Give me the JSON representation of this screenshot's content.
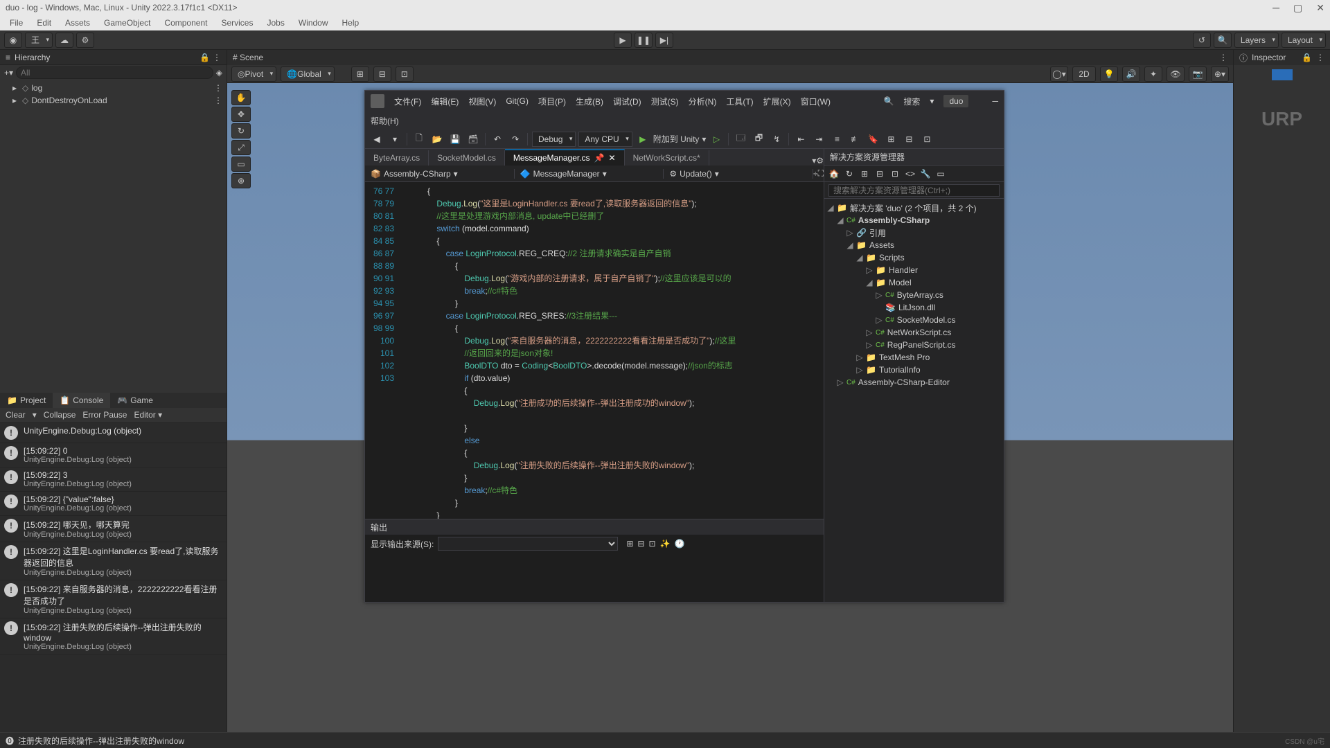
{
  "window": {
    "title": "duo - log - Windows, Mac, Linux - Unity 2022.3.17f1c1 <DX11>"
  },
  "menu": [
    "File",
    "Edit",
    "Assets",
    "GameObject",
    "Component",
    "Services",
    "Jobs",
    "Window",
    "Help"
  ],
  "toolbar": {
    "layers": "Layers",
    "layout": "Layout"
  },
  "hierarchy": {
    "title": "Hierarchy",
    "search_placeholder": "All",
    "items": [
      "log",
      "DontDestroyOnLoad"
    ]
  },
  "scene": {
    "tab": "Scene",
    "pivot": "Pivot",
    "global": "Global",
    "twoD": "2D"
  },
  "inspector": {
    "tab": "Inspector",
    "urp": "URP"
  },
  "consoleTabs": {
    "project": "Project",
    "console": "Console",
    "game": "Game"
  },
  "consoleBar": {
    "clear": "Clear",
    "collapse": "Collapse",
    "errorPause": "Error Pause",
    "editor": "Editor"
  },
  "console": [
    {
      "l1": "UnityEngine.Debug:Log (object)",
      "l2": ""
    },
    {
      "l1": "[15:09:22] 0",
      "l2": "UnityEngine.Debug:Log (object)"
    },
    {
      "l1": "[15:09:22] 3",
      "l2": "UnityEngine.Debug:Log (object)"
    },
    {
      "l1": "[15:09:22] {\"value\":false}",
      "l2": "UnityEngine.Debug:Log (object)"
    },
    {
      "l1": "[15:09:22] 哪天见，哪天算完",
      "l2": "UnityEngine.Debug:Log (object)"
    },
    {
      "l1": "[15:09:22] 这里是LoginHandler.cs 要read了,读取服务器返回的信息",
      "l2": "UnityEngine.Debug:Log (object)"
    },
    {
      "l1": "[15:09:22] 来自服务器的消息，2222222222看看注册是否成功了",
      "l2": "UnityEngine.Debug:Log (object)"
    },
    {
      "l1": "[15:09:22] 注册失败的后续操作--弹出注册失败的window",
      "l2": "UnityEngine.Debug:Log (object)"
    }
  ],
  "status": {
    "msg": "注册失败的后续操作--弹出注册失败的window",
    "credit": "CSDN @u宅"
  },
  "vs": {
    "menu": [
      "文件(F)",
      "编辑(E)",
      "视图(V)",
      "Git(G)",
      "项目(P)",
      "生成(B)",
      "调试(D)",
      "测试(S)",
      "分析(N)",
      "工具(T)",
      "扩展(X)",
      "窗口(W)",
      "帮助(H)"
    ],
    "search_label": "搜索",
    "search_val": "",
    "app": "duo",
    "toolbar": {
      "cfg": "Debug",
      "platform": "Any CPU",
      "attach": "附加到 Unity"
    },
    "tabs": [
      {
        "label": "ByteArray.cs",
        "active": false
      },
      {
        "label": "SocketModel.cs",
        "active": false
      },
      {
        "label": "MessageManager.cs",
        "active": true,
        "pin": true
      },
      {
        "label": "NetWorkScript.cs*",
        "active": false
      }
    ],
    "crumb": {
      "asm": "Assembly-CSharp",
      "cls": "MessageManager",
      "mth": "Update()"
    },
    "lines_start": 76,
    "lines_end": 103,
    "output": {
      "tab": "输出",
      "src": "显示输出来源(S):"
    },
    "sln": {
      "title": "解决方案资源管理器",
      "search_placeholder": "搜索解决方案资源管理器(Ctrl+;)",
      "root": "解决方案 'duo' (2 个项目，共 2 个)",
      "proj1": "Assembly-CSharp",
      "ref": "引用",
      "assets": "Assets",
      "scripts": "Scripts",
      "handler": "Handler",
      "model": "Model",
      "files_model": [
        "ByteArray.cs",
        "LitJson.dll",
        "SocketModel.cs"
      ],
      "files1": [
        "NetWorkScript.cs",
        "RegPanelScript.cs"
      ],
      "tm": "TextMesh Pro",
      "tut": "TutorialInfo",
      "proj2": "Assembly-CSharp-Editor"
    }
  },
  "code": {
    "l76": "            {",
    "l77a": "                Debug.Log(",
    "l77b": "\"这里是LoginHandler.cs 要read了,读取服务器返回的信息\"",
    "l77c": ");",
    "l78": "                //这里是处理游戏内部消息, update中已经删了",
    "l79a": "                switch",
    "l79b": " (model.command)",
    "l80": "                {",
    "l81a": "                    case ",
    "l81b": "LoginProtocol",
    "l81c": ".REG_CREQ:",
    "l81d": "//2 注册请求确实是自产自销",
    "l82": "                        {",
    "l83a": "                            Debug.Log(",
    "l83b": "\"游戏内部的注册请求，属于自产自销了\"",
    "l83c": ");",
    "l83d": "//这里应该是可以的",
    "l84a": "                            break",
    "l84b": ";",
    "l84c": "//c#特色",
    "l85": "                        }",
    "l86a": "                    case ",
    "l86b": "LoginProtocol",
    "l86c": ".REG_SRES:",
    "l86d": "//3注册结果---",
    "l87": "                        {",
    "l88a": "                            Debug.Log(",
    "l88b": "\"来自服务器的消息，2222222222看看注册是否成功了\"",
    "l88c": ");",
    "l88d": "//这里",
    "l89": "                            //返回回来的是json对象!",
    "l90a": "                            BoolDTO",
    "l90b": " dto = ",
    "l90c": "Coding",
    "l90d": "<",
    "l90e": "BoolDTO",
    "l90f": ">.decode(model.message);",
    "l90g": "//json的标志",
    "l91a": "                            if",
    "l91b": " (dto.value)",
    "l92": "                            {",
    "l93a": "                                Debug.Log(",
    "l93b": "\"注册成功的后续操作--弹出注册成功的window\"",
    "l93c": ");",
    "l94": "",
    "l95": "                            }",
    "l96": "                            else",
    "l97": "                            {",
    "l98a": "                                Debug.Log(",
    "l98b": "\"注册失败的后续操作--弹出注册失败的window\"",
    "l98c": ");",
    "l99": "                            }",
    "l100a": "                            break",
    "l100b": ";",
    "l100c": "//c#特色",
    "l101": "                        }",
    "l102": "                }",
    "l103": "            }"
  }
}
